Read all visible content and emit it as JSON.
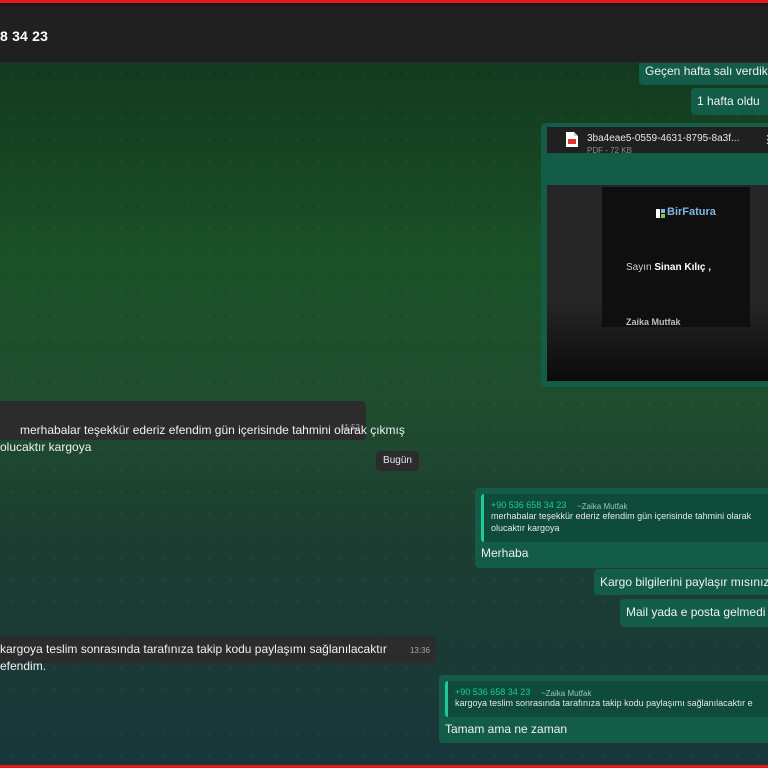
{
  "header": {
    "title": "8 34 23"
  },
  "messages": {
    "m1": "Geçen hafta salı verdik",
    "m2": "1 hafta oldu",
    "incoming1": {
      "text": "merhabalar teşekkür ederiz efendim gün içerisinde tahmini olarak çıkmış\nolucaktır kargoya",
      "time": "11:52"
    },
    "day_divider": "Bugün",
    "reply1": {
      "quote_sender": "+90 536 658 34 23",
      "quote_name": "~Zaika Mutfak",
      "quote_text": "merhabalar teşekkür ederiz efendim gün içerisinde tahmini olarak\nolucaktır kargoya",
      "text": "Merhaba"
    },
    "m3": "Kargo bilgilerini paylaşır mısınız",
    "m4": "Mail yada e posta gelmedi",
    "incoming2": {
      "text": "kargoya teslim sonrasında tarafınıza takip kodu paylaşımı sağlanılacaktır efendim.",
      "time": "13:36"
    },
    "reply2": {
      "quote_sender": "+90 536 658 34 23",
      "quote_name": "~Zaika Mutfak",
      "quote_text": "kargoya teslim sonrasında tarafınıza takip kodu paylaşımı sağlanılacaktır e",
      "text": "Tamam ama ne zaman"
    }
  },
  "document": {
    "filename": "3ba4eae5-0559-4631-8795-8a3f...",
    "meta": "PDF - 72 KB",
    "brand": "BirFatura",
    "greeting_prefix": "Sayın ",
    "greeting_name": "Sinan Kılıç ,",
    "company": "Zaika Mutfak"
  },
  "colors": {
    "outgoing": "#125c48",
    "incoming": "#2c2c2c",
    "accent": "#1fc99a",
    "frame": "#e5191b"
  },
  "icons": {
    "doc": "pdf-file-icon",
    "menu": "more-vertical-icon"
  }
}
